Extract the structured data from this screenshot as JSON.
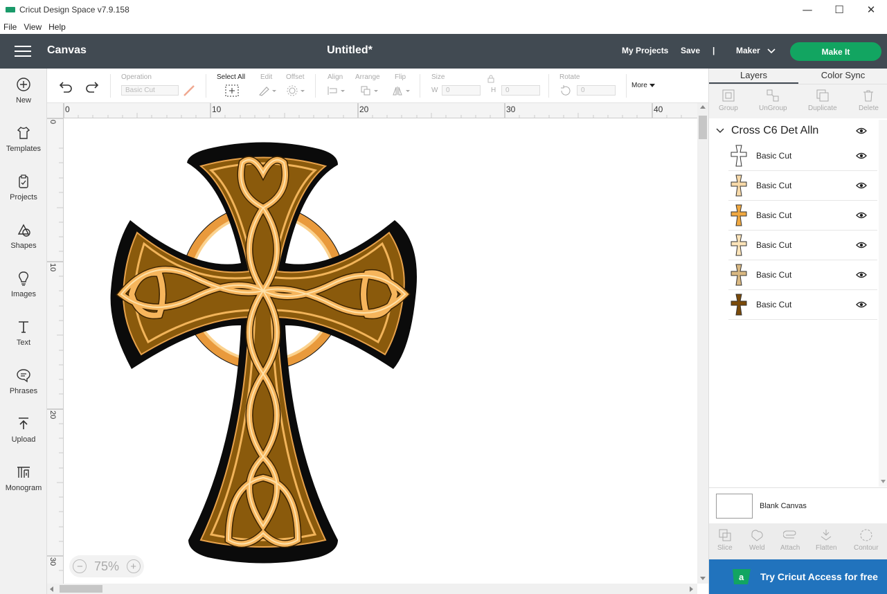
{
  "window": {
    "title": "Cricut Design Space  v7.9.158",
    "minimize": "—",
    "maximize": "☐",
    "close": "✕"
  },
  "menu": [
    "File",
    "View",
    "Help"
  ],
  "header": {
    "section": "Canvas",
    "document_title": "Untitled*",
    "my_projects": "My Projects",
    "save": "Save",
    "separator": "|",
    "machine": "Maker",
    "make_it": "Make It"
  },
  "sidebar": [
    {
      "label": "New",
      "icon": "plus-circle-icon"
    },
    {
      "label": "Templates",
      "icon": "tshirt-icon"
    },
    {
      "label": "Projects",
      "icon": "clipboard-icon"
    },
    {
      "label": "Shapes",
      "icon": "shapes-icon"
    },
    {
      "label": "Images",
      "icon": "lightbulb-icon"
    },
    {
      "label": "Text",
      "icon": "text-icon"
    },
    {
      "label": "Phrases",
      "icon": "speech-bubble-icon"
    },
    {
      "label": "Upload",
      "icon": "upload-icon"
    },
    {
      "label": "Monogram",
      "icon": "monogram-icon"
    }
  ],
  "toolbar": {
    "operation_label": "Operation",
    "operation_value": "Basic Cut",
    "select_all": "Select All",
    "edit": "Edit",
    "offset": "Offset",
    "align": "Align",
    "arrange": "Arrange",
    "flip": "Flip",
    "size": "Size",
    "w_label": "W",
    "w_value": "0",
    "h_label": "H",
    "h_value": "0",
    "rotate": "Rotate",
    "rotate_value": "0",
    "more": "More"
  },
  "ruler": {
    "h_ticks": [
      "0",
      "10",
      "20",
      "30",
      "40"
    ],
    "v_ticks": [
      "0",
      "10",
      "20",
      "30"
    ]
  },
  "zoom": {
    "level": "75%",
    "minus": "−",
    "plus": "+"
  },
  "panel": {
    "tabs": [
      "Layers",
      "Color Sync"
    ],
    "tools": [
      "Group",
      "UnGroup",
      "Duplicate",
      "Delete"
    ],
    "group_name": "Cross C6 Det Alln",
    "layers": [
      {
        "name": "Basic Cut",
        "color": "#ffffff"
      },
      {
        "name": "Basic Cut",
        "color": "#f7d9a8"
      },
      {
        "name": "Basic Cut",
        "color": "#f0a840"
      },
      {
        "name": "Basic Cut",
        "color": "#fbe3b8"
      },
      {
        "name": "Basic Cut",
        "color": "#d9b882"
      },
      {
        "name": "Basic Cut",
        "color": "#7a4a0a"
      }
    ],
    "blank_canvas": "Blank Canvas",
    "bottom_tools": [
      "Slice",
      "Weld",
      "Attach",
      "Flatten",
      "Contour"
    ],
    "access_banner": "Try Cricut Access for free"
  },
  "colors": {
    "header_bg": "#414a52",
    "make_it": "#12a561",
    "access": "#2173bd",
    "cross_dark": "#8a5a0c",
    "cross_gold": "#f2b45a",
    "cross_light": "#fbd28e"
  }
}
